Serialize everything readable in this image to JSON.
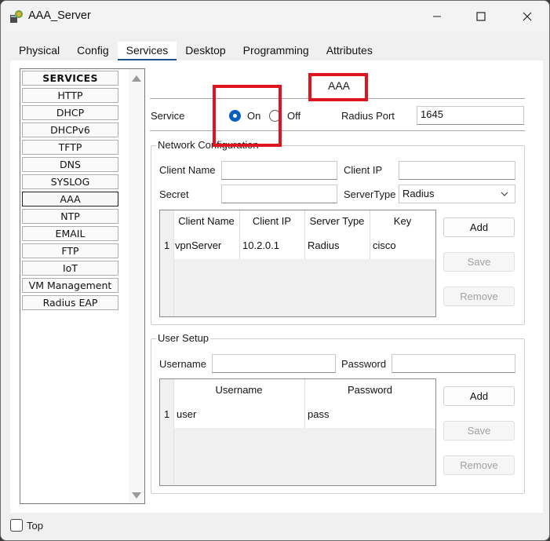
{
  "window": {
    "title": "AAA_Server"
  },
  "tabs": [
    {
      "label": "Physical",
      "active": false
    },
    {
      "label": "Config",
      "active": false
    },
    {
      "label": "Services",
      "active": true
    },
    {
      "label": "Desktop",
      "active": false
    },
    {
      "label": "Programming",
      "active": false
    },
    {
      "label": "Attributes",
      "active": false
    }
  ],
  "services": {
    "header": "SERVICES",
    "items": [
      "HTTP",
      "DHCP",
      "DHCPv6",
      "TFTP",
      "DNS",
      "SYSLOG",
      "AAA",
      "NTP",
      "EMAIL",
      "FTP",
      "IoT",
      "VM Management",
      "Radius EAP"
    ],
    "selected": "AAA"
  },
  "aaa": {
    "heading": "AAA",
    "service_label": "Service",
    "on_label": "On",
    "off_label": "Off",
    "service_state": "On",
    "radius_port_label": "Radius Port",
    "radius_port_value": "1645"
  },
  "network_config": {
    "title": "Network Configuration",
    "client_name_label": "Client Name",
    "client_name_value": "",
    "client_ip_label": "Client IP",
    "client_ip_value": "",
    "secret_label": "Secret",
    "secret_value": "",
    "server_type_label": "ServerType",
    "server_type_value": "Radius",
    "table": {
      "headers": [
        "Client Name",
        "Client IP",
        "Server Type",
        "Key"
      ],
      "rows": [
        {
          "index": "1",
          "client_name": "vpnServer",
          "client_ip": "10.2.0.1",
          "server_type": "Radius",
          "key": "cisco"
        }
      ]
    },
    "buttons": {
      "add": "Add",
      "save": "Save",
      "remove": "Remove"
    }
  },
  "user_setup": {
    "title": "User Setup",
    "username_label": "Username",
    "username_value": "",
    "password_label": "Password",
    "password_value": "",
    "table": {
      "headers": [
        "Username",
        "Password"
      ],
      "rows": [
        {
          "index": "1",
          "username": "user",
          "password": "pass"
        }
      ]
    },
    "buttons": {
      "add": "Add",
      "save": "Save",
      "remove": "Remove"
    }
  },
  "footer": {
    "top_label": "Top",
    "top_checked": false
  },
  "colors": {
    "accent": "#0a5fbf",
    "highlight": "#e0141e",
    "tab_underline": "#1b4f8a"
  }
}
